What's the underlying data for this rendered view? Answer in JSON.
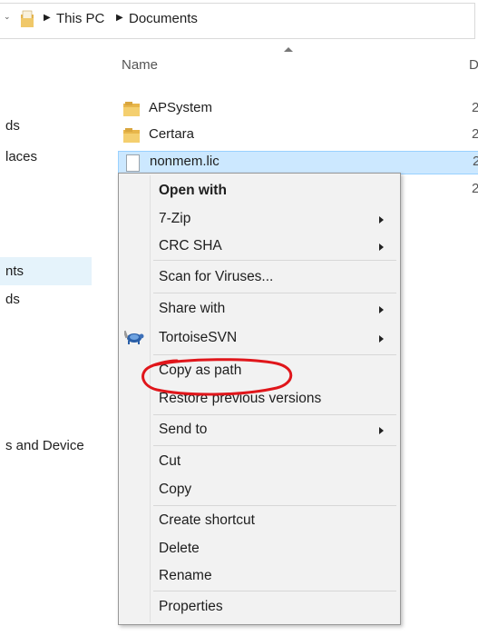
{
  "address_bar": {
    "crumbs": [
      "This PC",
      "Documents"
    ]
  },
  "columns": {
    "name": "Name",
    "date": "D"
  },
  "nav_pane": {
    "items": [
      "ds",
      "laces",
      "nts",
      "ds",
      "s and Device"
    ]
  },
  "files": [
    {
      "name": "APSystem",
      "date": "2",
      "type": "folder"
    },
    {
      "name": "Certara",
      "date": "2",
      "type": "folder"
    },
    {
      "name": "nonmem.lic",
      "date": "2",
      "type": "file",
      "selected": true
    },
    {
      "name": "",
      "date": "2",
      "type": "hidden"
    }
  ],
  "context_menu": {
    "items": {
      "open_with": "Open with",
      "seven_zip": "7-Zip",
      "crc_sha": "CRC SHA",
      "scan": "Scan for Viruses...",
      "share_with": "Share with",
      "tortoise": "TortoiseSVN",
      "copy_as_path": "Copy as path",
      "restore": "Restore previous versions",
      "send_to": "Send to",
      "cut": "Cut",
      "copy": "Copy",
      "create_shortcut": "Create shortcut",
      "delete": "Delete",
      "rename": "Rename",
      "properties": "Properties"
    }
  },
  "colors": {
    "selection": "#cce8ff",
    "annotation": "#e0161b",
    "folder": "#e8b64a"
  }
}
